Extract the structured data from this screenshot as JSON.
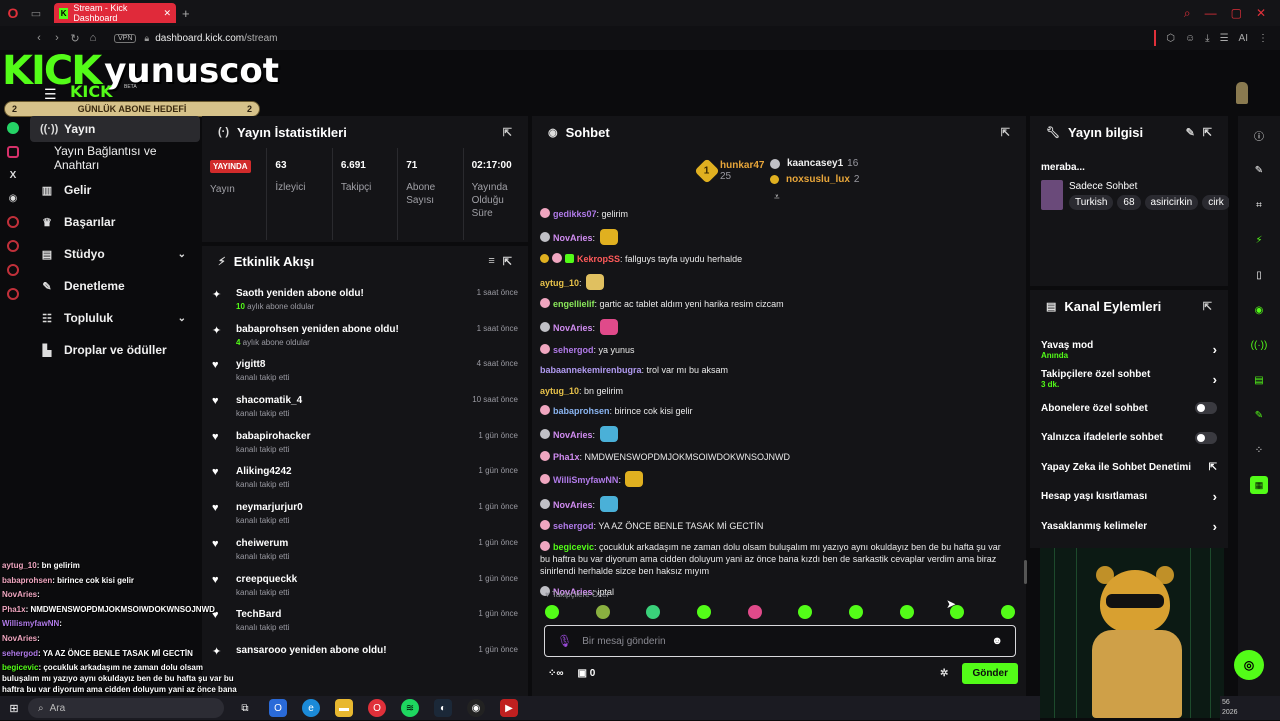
{
  "browser": {
    "tab_title": "Stream - Kick Dashboard",
    "url_domain": "dashboard.kick.com",
    "url_path": "/stream",
    "vpn_label": "VPN",
    "ai_label": "AI"
  },
  "overlay": {
    "logo_text": "KICK",
    "streamer_name": "yunuscot",
    "mini_logo": "KICK",
    "beta": "BETA",
    "goal_label": "GÜNLÜK ABONE HEDEFİ",
    "goal_left": "2",
    "goal_right": "2"
  },
  "sidebar": {
    "items": [
      {
        "label": "Yayın",
        "icon": "live-icon"
      },
      {
        "label": "Yayın Bağlantısı ve Anahtarı"
      },
      {
        "label": "Gelir",
        "icon": "chart-icon"
      },
      {
        "label": "Başarılar",
        "icon": "trophy-icon"
      },
      {
        "label": "Stüdyo",
        "icon": "studio-icon"
      },
      {
        "label": "Denetleme",
        "icon": "wrench-icon"
      },
      {
        "label": "Topluluk",
        "icon": "community-icon"
      },
      {
        "label": "Droplar ve ödüller",
        "icon": "drops-icon"
      }
    ]
  },
  "stats_panel": {
    "title": "Yayın İstatistikleri",
    "live_badge": "YAYINDA",
    "live_label": "Yayın",
    "viewers_value": "63",
    "viewers_label": "İzleyici",
    "followers_value": "6.691",
    "followers_label": "Takipçi",
    "subs_value": "71",
    "subs_label": "Abone Sayısı",
    "uptime_value": "02:17:00",
    "uptime_label": "Yayında Olduğu Süre"
  },
  "events_panel": {
    "title": "Etkinlik Akışı",
    "items": [
      {
        "title": "Saoth yeniden abone oldu!",
        "count": "10",
        "sub_rest": " aylık abone oldular",
        "time": "1 saat önce",
        "icon": "sparkle-icon"
      },
      {
        "title": "babaprohsen yeniden abone oldu!",
        "count": "4",
        "sub_rest": " aylık abone oldular",
        "time": "1 saat önce",
        "icon": "sparkle-icon"
      },
      {
        "title": "yigitt8",
        "sub": "kanalı takip etti",
        "time": "4 saat önce",
        "icon": "heart-icon"
      },
      {
        "title": "shacomatik_4",
        "sub": "kanalı takip etti",
        "time": "10 saat önce",
        "icon": "heart-icon"
      },
      {
        "title": "babapirohacker",
        "sub": "kanalı takip etti",
        "time": "1 gün önce",
        "icon": "heart-icon"
      },
      {
        "title": "Aliking4242",
        "sub": "kanalı takip etti",
        "time": "1 gün önce",
        "icon": "heart-icon"
      },
      {
        "title": "neymarjurjur0",
        "sub": "kanalı takip etti",
        "time": "1 gün önce",
        "icon": "heart-icon"
      },
      {
        "title": "cheiwerum",
        "sub": "kanalı takip etti",
        "time": "1 gün önce",
        "icon": "heart-icon"
      },
      {
        "title": "creepqueckk",
        "sub": "kanalı takip etti",
        "time": "1 gün önce",
        "icon": "heart-icon"
      },
      {
        "title": "TechBard",
        "sub": "kanalı takip etti",
        "time": "1 gün önce",
        "icon": "heart-icon"
      },
      {
        "title": "sansarooo yeniden abone oldu!",
        "sub": "",
        "time": "1 gün önce",
        "icon": "sparkle-icon"
      }
    ]
  },
  "chat_panel": {
    "title": "Sohbet",
    "leaders": [
      {
        "rank": "1",
        "name": "hunkar47",
        "count": "25"
      },
      {
        "name": "kaancasey1",
        "count": "16"
      },
      {
        "name": "noxsuslu_lux",
        "count": "2"
      }
    ],
    "messages": [
      {
        "user": "gedikks07",
        "text": ": gelirim",
        "color": "#b07ae8",
        "badge": "pig"
      },
      {
        "user": "NovAries",
        "text": ":",
        "color": "#d08cf0",
        "badge": "gray",
        "emote": "#e0b020"
      },
      {
        "user": "KekropSS",
        "text": ": fallguys tayfa uyudu herhalde",
        "color": "#ff5a5a",
        "badge": "gold"
      },
      {
        "user": "aytug_10",
        "text": ":",
        "color": "#e8c24a",
        "badge": "",
        "emote": "#e0c060"
      },
      {
        "user": "engellielif",
        "text": ": gartic ac tablet aldım yeni harika resim cizcam",
        "color": "#8ae85a",
        "badge": "pig"
      },
      {
        "user": "NovAries",
        "text": ":",
        "color": "#d08cf0",
        "badge": "gray",
        "emote": "#e04a8a"
      },
      {
        "user": "sehergod",
        "text": ": ya yunus",
        "color": "#b07ae8",
        "badge": "pig"
      },
      {
        "user": "babaannekemirenbugra",
        "text": ": trol var mı bu aksam",
        "color": "#b09af0",
        "badge": ""
      },
      {
        "user": "aytug_10",
        "text": ": bn gelirim",
        "color": "#e8c24a",
        "badge": ""
      },
      {
        "user": "babaprohsen",
        "text": ": birince cok kisi gelir",
        "color": "#8ab4f0",
        "badge": "pig"
      },
      {
        "user": "NovAries",
        "text": ":",
        "color": "#d08cf0",
        "badge": "gray",
        "emote": "#4ab0d8"
      },
      {
        "user": "Pha1x",
        "text": ": NMDWENSWOPDMJOKMSOIWDOKWNSOJNWD",
        "color": "#d08cf0",
        "badge": "pig"
      },
      {
        "user": "WilliSmyfawNN",
        "text": ":",
        "color": "#b07ae8",
        "badge": "pig",
        "emote": "#e0b020"
      },
      {
        "user": "NovAries",
        "text": ":",
        "color": "#d08cf0",
        "badge": "gray",
        "emote": "#4ab0d8"
      },
      {
        "user": "sehergod",
        "text": ": YA AZ ÖNCE BENLE TASAK Mİ GECTİN",
        "color": "#b07ae8",
        "badge": "pig"
      },
      {
        "user": "begicevic",
        "text": ": çocukluk arkadaşım ne zaman dolu olsam buluşalım mı yazıyo aynı okuldayız ben de bu hafta şu var bu haftra bu var diyorum ama cidden doluyum yani az önce bana kızdı ben de sarkastik cevaplar verdim ama biraz sinirlendi herhalde sizce ben haksız mıyım",
        "color": "#53fc18",
        "badge": "pig"
      },
      {
        "user": "NovAries",
        "text": ": iptal",
        "color": "#d08cf0",
        "badge": "gray"
      }
    ],
    "follower_only": "Takipçilere Özel",
    "input_placeholder": "Bir mesaj gönderin",
    "points": "0",
    "send_label": "Gönder",
    "emote_colors": [
      "#53fc18",
      "#8ab040",
      "#3ad07a",
      "#53fc18",
      "#e04a8a",
      "#53fc18",
      "#53fc18",
      "#53fc18",
      "#53fc18",
      "#53fc18"
    ]
  },
  "info_panel": {
    "title": "Yayın bilgisi",
    "stream_title": "meraba...",
    "category": "Sadece Sohbet",
    "tags": [
      "Turkish",
      "68",
      "asiricirkin",
      "cirk"
    ]
  },
  "actions_panel": {
    "title": "Kanal Eylemleri",
    "items": [
      {
        "label": "Yavaş mod",
        "sub": "Anında",
        "kind": "arrow"
      },
      {
        "label": "Takipçilere özel sohbet",
        "sub": "3 dk.",
        "kind": "arrow"
      },
      {
        "label": "Abonelere özel sohbet",
        "kind": "toggle"
      },
      {
        "label": "Yalnızca ifadelerle sohbet",
        "kind": "toggle"
      },
      {
        "label": "Yapay Zeka ile Sohbet Denetimi",
        "kind": "ext"
      },
      {
        "label": "Hesap yaşı kısıtlaması",
        "kind": "arrow"
      },
      {
        "label": "Yasaklanmış kelimeler",
        "kind": "arrow"
      }
    ]
  },
  "overlay_chat": [
    {
      "user": "aytug_10",
      "text": ": bn gelirim"
    },
    {
      "user": "babaprohsen",
      "text": ": birince cok kisi gelir"
    },
    {
      "user": "NovAries",
      "text": ":"
    },
    {
      "user": "Pha1x",
      "text": ": NMDWENSWOPDMJOKMSOIWDOKWNSOJNWD"
    },
    {
      "user": "WillismyfawNN",
      "text": ":"
    },
    {
      "user": "NovAries",
      "text": ":"
    },
    {
      "user": "sehergod",
      "text": ": YA AZ ÖNCE BENLE TASAK Mİ GECTİN"
    },
    {
      "user": "begicevic",
      "text": ": çocukluk arkadaşım ne zaman dolu olsam buluşalım mı yazıyo aynı okuldayız ben de bu hafta şu var bu haftra bu var diyorum ama cidden doluyum yani az önce bana kızdı ben de sarkastik cevaplar verdim ama biraz sinirlendi herhalde sizce"
    }
  ],
  "taskbar": {
    "search_label": "Ara",
    "tray_top": "56",
    "tray_bottom": "2026"
  }
}
